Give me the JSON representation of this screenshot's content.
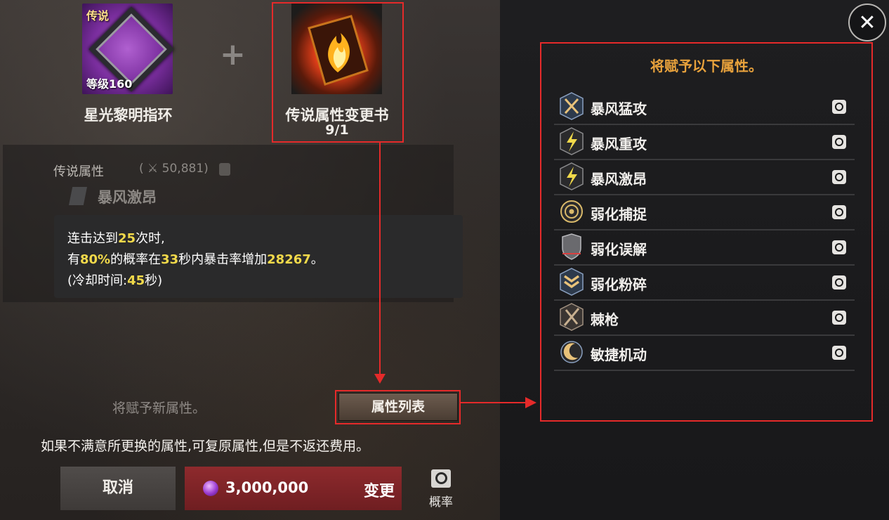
{
  "materials": {
    "ring": {
      "tag": "传说",
      "level": "等级160",
      "name": "星光黎明指环"
    },
    "plus": "+",
    "book": {
      "name": "传说属性变更书",
      "count": "9/1"
    }
  },
  "current_attr": {
    "title": "传说属性",
    "score": "( ⚔ 50,881)",
    "name": "暴风激昂",
    "desc": {
      "line1_a": "连击达到",
      "line1_b": "25",
      "line1_c": "次时,",
      "line2_a": "有",
      "line2_b": "80%",
      "line2_c": "的概率在",
      "line2_d": "33",
      "line2_e": "秒内暴击率增加",
      "line2_f": "28267",
      "line2_g": "。",
      "line3_a": "(冷却时间:",
      "line3_b": "45",
      "line3_c": "秒)"
    }
  },
  "new_attr_text": "将赋予新属性。",
  "attr_list_button": "属性列表",
  "warning": "如果不满意所更换的属性,可复原属性,但是不返还费用。",
  "cancel_button": "取消",
  "change_button": {
    "cost": "3,000,000",
    "label": "变更"
  },
  "probability_label": "概率",
  "close_button": "✕",
  "attr_list": {
    "heading": "将赋予以下属性。",
    "items": [
      {
        "label": "暴风猛攻",
        "icon": "crossed-swords-icon"
      },
      {
        "label": "暴风重攻",
        "icon": "lightning-icon"
      },
      {
        "label": "暴风激昂",
        "icon": "lightning-icon"
      },
      {
        "label": "弱化捕捉",
        "icon": "target-icon"
      },
      {
        "label": "弱化误解",
        "icon": "shield-icon"
      },
      {
        "label": "弱化粉碎",
        "icon": "chevron-shield-icon"
      },
      {
        "label": "棘枪",
        "icon": "spear-icon"
      },
      {
        "label": "敏捷机动",
        "icon": "crescent-icon"
      }
    ]
  },
  "colors": {
    "highlight": "#f1d94a",
    "accent": "#e8a23c",
    "annotation": "#e52a2a",
    "change_button": "#8e2a2d"
  }
}
